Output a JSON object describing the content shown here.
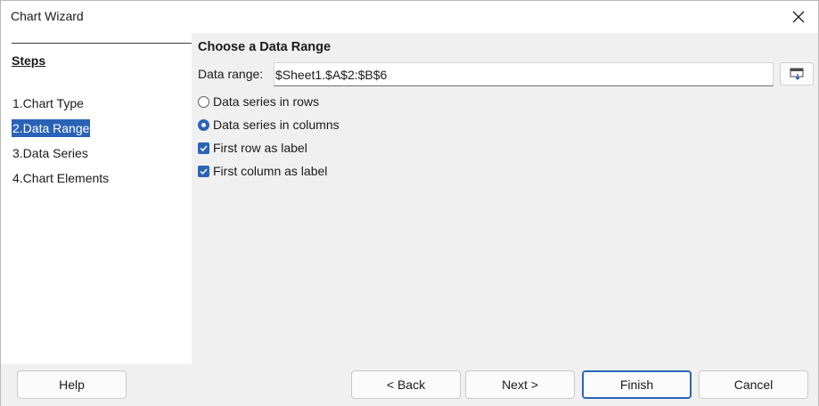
{
  "window": {
    "title": "Chart Wizard"
  },
  "steps": {
    "title": "Steps",
    "items": [
      {
        "label": "1.Chart Type",
        "active": false
      },
      {
        "label": "2.Data Range",
        "active": true
      },
      {
        "label": "3.Data Series",
        "active": false
      },
      {
        "label": "4.Chart Elements",
        "active": false
      }
    ]
  },
  "main": {
    "title": "Choose a Data Range",
    "range_label": "Data range:",
    "range_value": "$Sheet1.$A$2:$B$6",
    "options": {
      "rows": {
        "label": "Data series in rows",
        "checked": false
      },
      "columns": {
        "label": "Data series in columns",
        "checked": true
      },
      "first_row": {
        "label": "First row as label",
        "checked": true
      },
      "first_column": {
        "label": "First column as label",
        "checked": true
      }
    }
  },
  "buttons": {
    "help": "Help",
    "back": "< Back",
    "next": "Next >",
    "finish": "Finish",
    "cancel": "Cancel"
  },
  "icons": {
    "close": "close-icon",
    "shrink": "shrink-range-icon"
  },
  "colors": {
    "accent": "#2a62b6",
    "panel": "#f0f0f0",
    "sidebar": "#ffffff"
  }
}
